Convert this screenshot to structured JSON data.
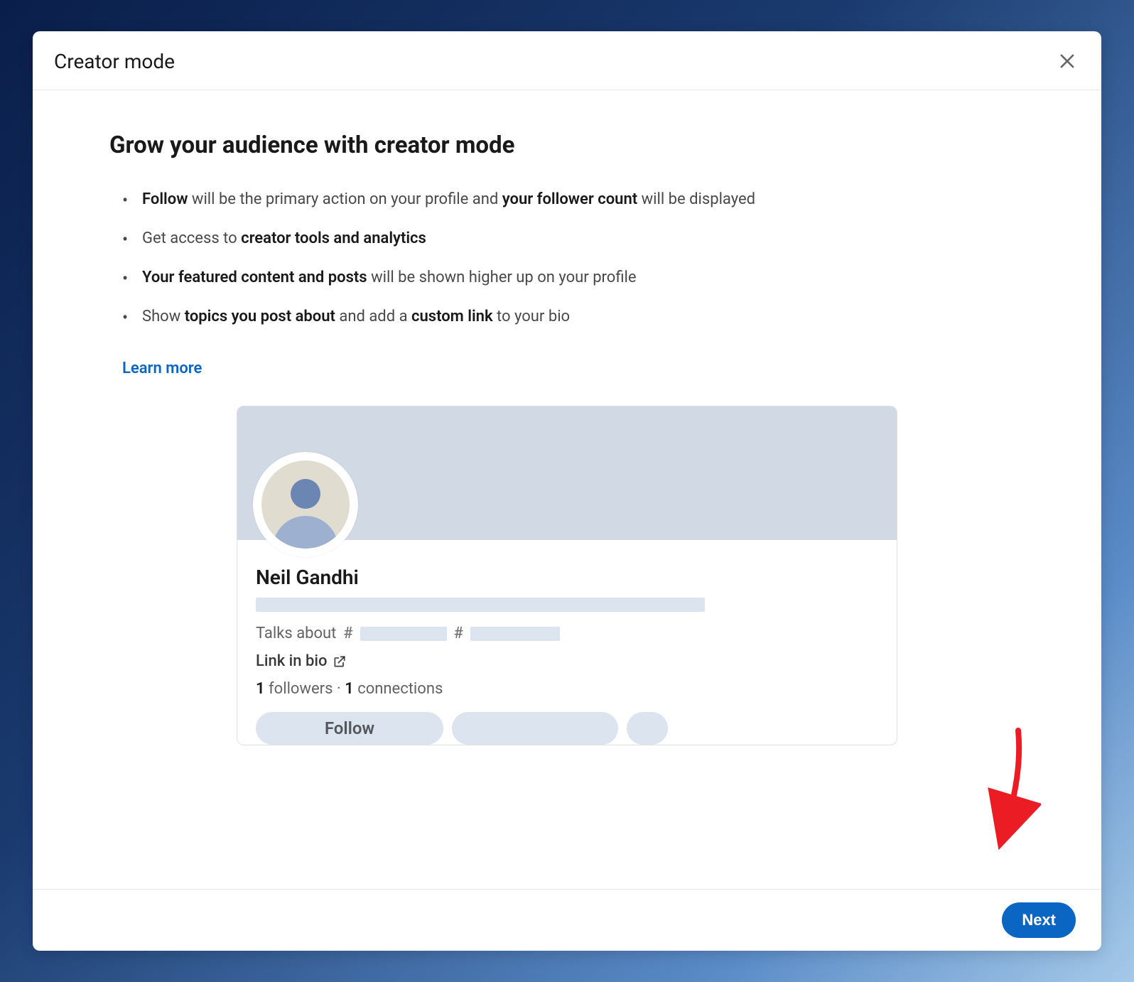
{
  "header": {
    "title": "Creator mode"
  },
  "content": {
    "heading": "Grow your audience with creator mode",
    "bullets": {
      "b1_strong1": "Follow",
      "b1_text1": " will be the primary action on your profile and ",
      "b1_strong2": "your follower count",
      "b1_text2": " will be displayed",
      "b2_text1": "Get access to ",
      "b2_strong1": "creator tools and analytics",
      "b3_strong1": "Your featured content and posts",
      "b3_text1": " will be shown higher up on your profile",
      "b4_text1": "Show ",
      "b4_strong1": "topics you post about",
      "b4_text2": " and add a ",
      "b4_strong2": "custom link",
      "b4_text3": " to your bio"
    },
    "learn_more": "Learn more"
  },
  "profile": {
    "name": "Neil Gandhi",
    "talks_about": "Talks about",
    "hash": "#",
    "link_in_bio": "Link in bio",
    "followers_count": "1",
    "followers_label": " followers",
    "separator": " · ",
    "connections_count": "1",
    "connections_label": " connections",
    "follow_label": "Follow"
  },
  "footer": {
    "next": "Next"
  }
}
